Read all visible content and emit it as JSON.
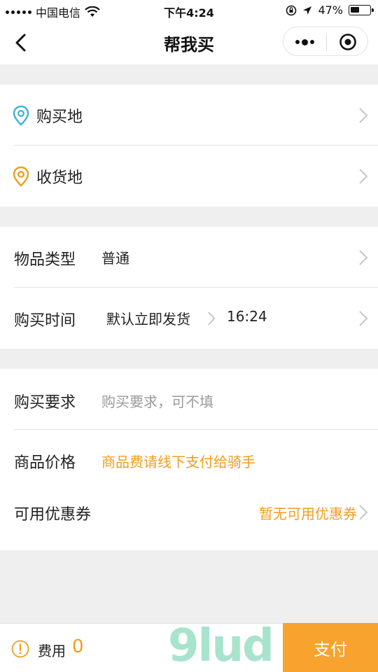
{
  "status_bar": {
    "carrier": "中国电信",
    "time": "下午4:24",
    "battery_percent": "47%",
    "battery_level": 0.47,
    "icons": [
      "signal-dots-icon",
      "wifi-icon",
      "orientation-lock-icon",
      "location-arrow-icon",
      "battery-icon"
    ]
  },
  "nav": {
    "title": "帮我买",
    "back_icon": "chevron-left-icon",
    "more_icon": "more-dots-icon",
    "close_icon": "target-circle-icon"
  },
  "address_section": {
    "purchase_location": "购买地",
    "delivery_location": "收货地",
    "purchase_pin_color": "#3bb4d8",
    "delivery_pin_color": "#f19d1f"
  },
  "item_section": {
    "item_type_label": "物品类型",
    "item_type_value": "普通",
    "purchase_time_label": "购买时间",
    "purchase_time_value": "默认立即发货",
    "purchase_time_clock": "16:24"
  },
  "details_section": {
    "requirement_label": "购买要求",
    "requirement_placeholder": "购买要求，可不填",
    "price_label": "商品价格",
    "price_value": "商品费请线下支付给骑手",
    "coupon_label": "可用优惠券",
    "coupon_value": "暂无可用优惠券"
  },
  "bottom_bar": {
    "fee_label": "费用",
    "fee_value": "0",
    "pay_label": "支付",
    "watermark": "9lud"
  },
  "colors": {
    "accent_orange": "#f19d1f",
    "pay_button": "#f7a32e",
    "page_bg": "#efefef"
  }
}
